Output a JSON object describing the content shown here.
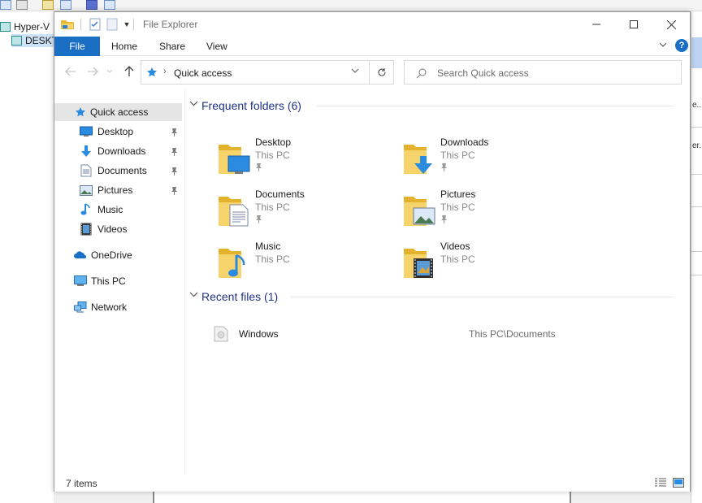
{
  "background": {
    "tree": [
      {
        "label": "Hyper-V"
      },
      {
        "label": "DESKT"
      }
    ],
    "right_edge_texts": [
      "e...",
      "er..."
    ]
  },
  "window": {
    "title": "File Explorer",
    "controls": {
      "minimize": "—",
      "maximize": "☐",
      "close": "✕"
    }
  },
  "ribbon": {
    "file_tab": "File",
    "tabs": [
      {
        "label": "Home"
      },
      {
        "label": "Share"
      },
      {
        "label": "View"
      }
    ],
    "help": "?"
  },
  "address": {
    "location": "Quick access",
    "search_placeholder": "Search Quick access"
  },
  "navigation": {
    "quick_access": "Quick access",
    "pinned": [
      {
        "label": "Desktop",
        "icon": "desktop-icon",
        "pinned": true
      },
      {
        "label": "Downloads",
        "icon": "downloads-icon",
        "pinned": true
      },
      {
        "label": "Documents",
        "icon": "documents-icon",
        "pinned": true
      },
      {
        "label": "Pictures",
        "icon": "pictures-icon",
        "pinned": true
      },
      {
        "label": "Music",
        "icon": "music-icon",
        "pinned": false
      },
      {
        "label": "Videos",
        "icon": "videos-icon",
        "pinned": false
      }
    ],
    "onedrive": "OneDrive",
    "this_pc": "This PC",
    "network": "Network"
  },
  "frequent_folders": {
    "header": "Frequent folders (6)",
    "items": [
      {
        "name": "Desktop",
        "location": "This PC",
        "pinned": true,
        "icon": "desktop-folder-icon"
      },
      {
        "name": "Downloads",
        "location": "This PC",
        "pinned": true,
        "icon": "downloads-folder-icon"
      },
      {
        "name": "Documents",
        "location": "This PC",
        "pinned": true,
        "icon": "documents-folder-icon"
      },
      {
        "name": "Pictures",
        "location": "This PC",
        "pinned": true,
        "icon": "pictures-folder-icon"
      },
      {
        "name": "Music",
        "location": "This PC",
        "pinned": false,
        "icon": "music-folder-icon"
      },
      {
        "name": "Videos",
        "location": "This PC",
        "pinned": false,
        "icon": "videos-folder-icon"
      }
    ]
  },
  "recent_files": {
    "header": "Recent files (1)",
    "items": [
      {
        "name": "Windows",
        "path": "This PC\\Documents"
      }
    ]
  },
  "status": {
    "item_count": "7 items"
  },
  "colors": {
    "accent": "#1a6fc4",
    "group_header": "#1e3287",
    "folder_yellow": "#f5c842"
  }
}
